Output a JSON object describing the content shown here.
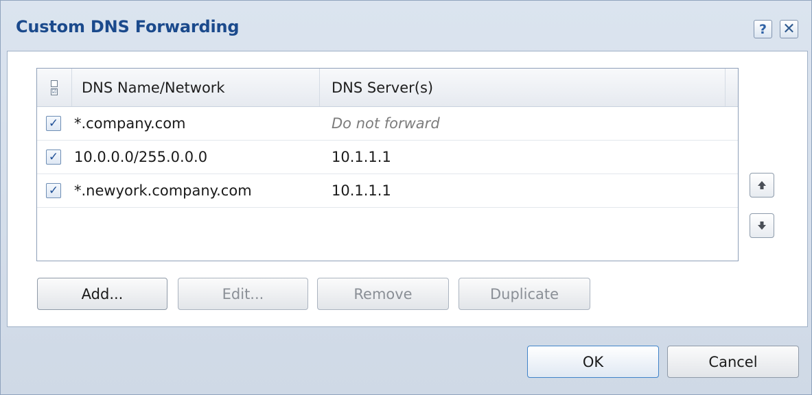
{
  "dialog": {
    "title": "Custom DNS Forwarding",
    "help_label": "?",
    "close_label": "✕"
  },
  "table": {
    "columns": [
      "DNS Name/Network",
      "DNS Server(s)"
    ],
    "rows": [
      {
        "checked": true,
        "name": "*.company.com",
        "server": "Do not forward"
      },
      {
        "checked": true,
        "name": "10.0.0.0/255.0.0.0",
        "server": "10.1.1.1"
      },
      {
        "checked": true,
        "name": "*.newyork.company.com",
        "server": "10.1.1.1"
      }
    ]
  },
  "icons": {
    "move_up": "arrow-up-icon",
    "move_down": "arrow-down-icon",
    "header_check": "select-all-checkbox-icon"
  },
  "buttons": {
    "add": "Add...",
    "edit": "Edit...",
    "remove": "Remove",
    "duplicate": "Duplicate",
    "ok": "OK",
    "cancel": "Cancel"
  },
  "colors": {
    "title": "#1b4a8c",
    "accent": "#3f82c8",
    "muted_text": "#7c7c7c"
  }
}
